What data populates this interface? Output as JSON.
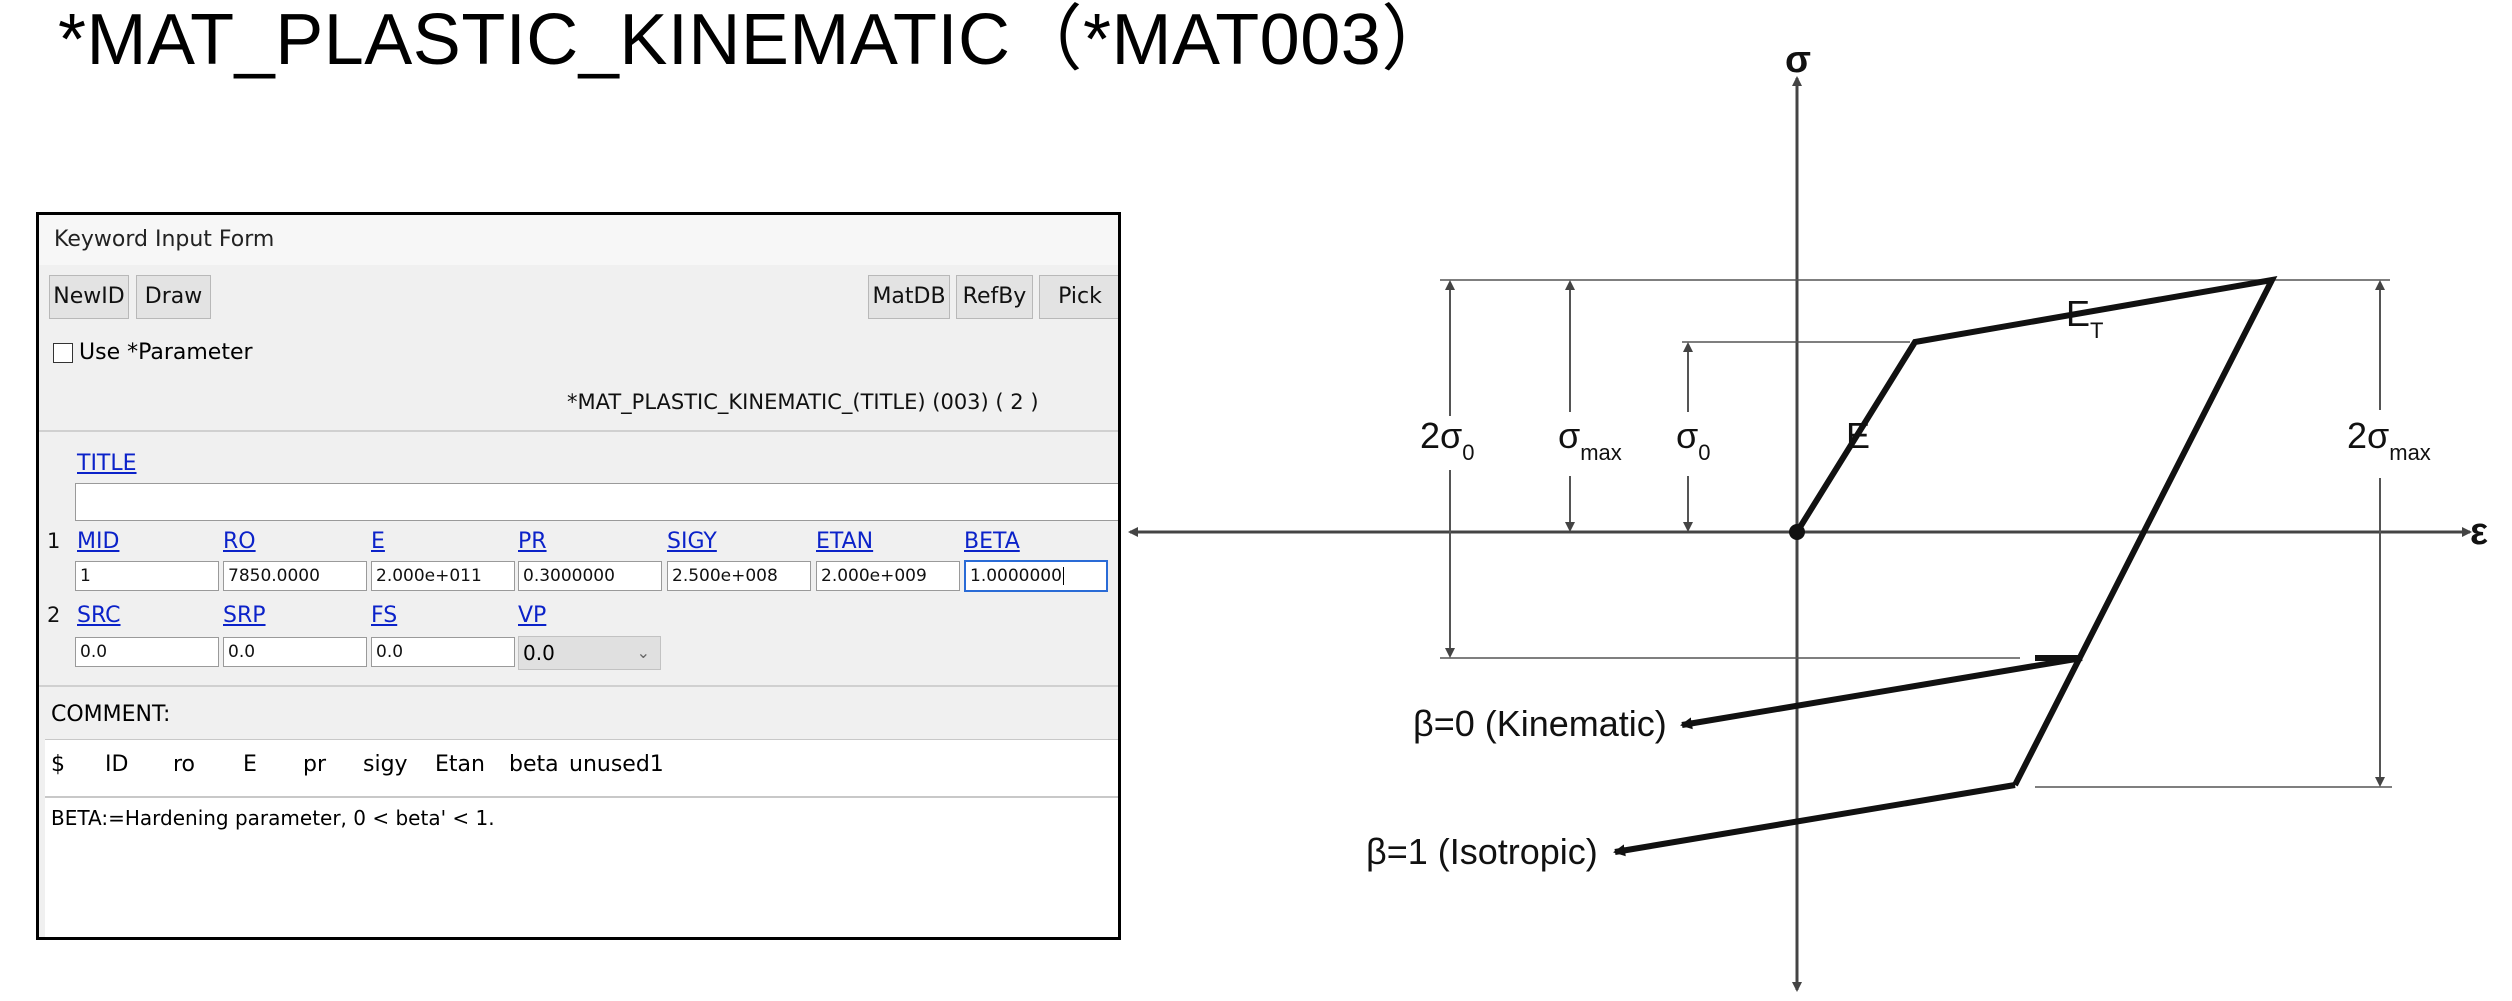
{
  "slide": {
    "title": "*MAT_PLASTIC_KINEMATIC（*MAT003）"
  },
  "form": {
    "window_title": "Keyword Input Form",
    "buttons": {
      "new_id": "NewID",
      "draw": "Draw",
      "matdb": "MatDB",
      "refby": "RefBy",
      "pick": "Pick"
    },
    "use_parameter_label": "Use *Parameter",
    "use_parameter_checked": false,
    "keyword_heading": "*MAT_PLASTIC_KINEMATIC_(TITLE) (003)   ( 2 )",
    "title_label": "TITLE",
    "title_value": "",
    "row1": {
      "row_number": "1",
      "fields": [
        {
          "label": "MID",
          "value": "1"
        },
        {
          "label": "RO",
          "value": "7850.0000"
        },
        {
          "label": "E",
          "value": "2.000e+011"
        },
        {
          "label": "PR",
          "value": "0.3000000"
        },
        {
          "label": "SIGY",
          "value": "2.500e+008"
        },
        {
          "label": "ETAN",
          "value": "2.000e+009"
        },
        {
          "label": "BETA",
          "value": "1.0000000"
        }
      ]
    },
    "row2": {
      "row_number": "2",
      "fields": [
        {
          "label": "SRC",
          "value": "0.0"
        },
        {
          "label": "SRP",
          "value": "0.0"
        },
        {
          "label": "FS",
          "value": "0.0"
        },
        {
          "label": "VP",
          "value": "0.0"
        }
      ]
    },
    "comment_label": "COMMENT:",
    "comment_header": [
      "$",
      "ID",
      "ro",
      "E",
      "pr",
      "sigy",
      "Etan",
      "beta",
      "unused1"
    ],
    "comment_text": "BETA:=Hardening parameter, 0 < beta' < 1.",
    "link_color": "#0b22c9"
  },
  "diagram": {
    "axis_sigma": "σ",
    "axis_epsilon": "ε",
    "labels": {
      "two_sigma0": {
        "main": "2σ",
        "sub": "0"
      },
      "sigma_max": {
        "main": "σ",
        "sub": "max"
      },
      "sigma0": {
        "main": "σ",
        "sub": "0"
      },
      "E": "E",
      "ET": {
        "main": "E",
        "sub": "T"
      },
      "two_sigma_max": {
        "main": "2σ",
        "sub": "max"
      }
    },
    "beta0": "β=0 (Kinematic)",
    "beta1": "β=1 (Isotropic)"
  }
}
